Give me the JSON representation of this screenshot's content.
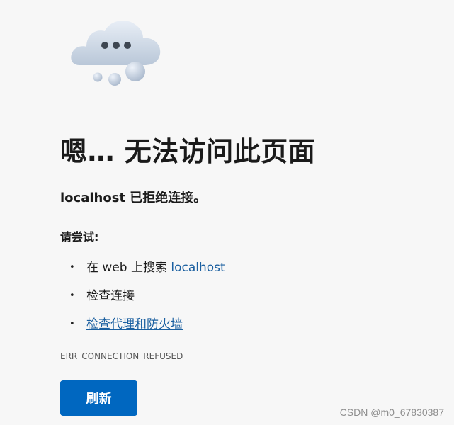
{
  "error_page": {
    "icon": "sad-cloud-icon",
    "title": "嗯… 无法访问此页面",
    "subtitle": "localhost 已拒绝连接。",
    "try_label": "请尝试:",
    "suggestions": [
      {
        "prefix": "在 web 上搜索 ",
        "link": "localhost"
      },
      {
        "text": "检查连接"
      },
      {
        "link": "检查代理和防火墙"
      }
    ],
    "error_code": "ERR_CONNECTION_REFUSED",
    "refresh_label": "刷新"
  },
  "watermark": "CSDN @m0_67830387",
  "colors": {
    "background": "#f7f7f7",
    "link": "#1a5fa0",
    "button": "#0067c0",
    "button_text": "#ffffff"
  }
}
